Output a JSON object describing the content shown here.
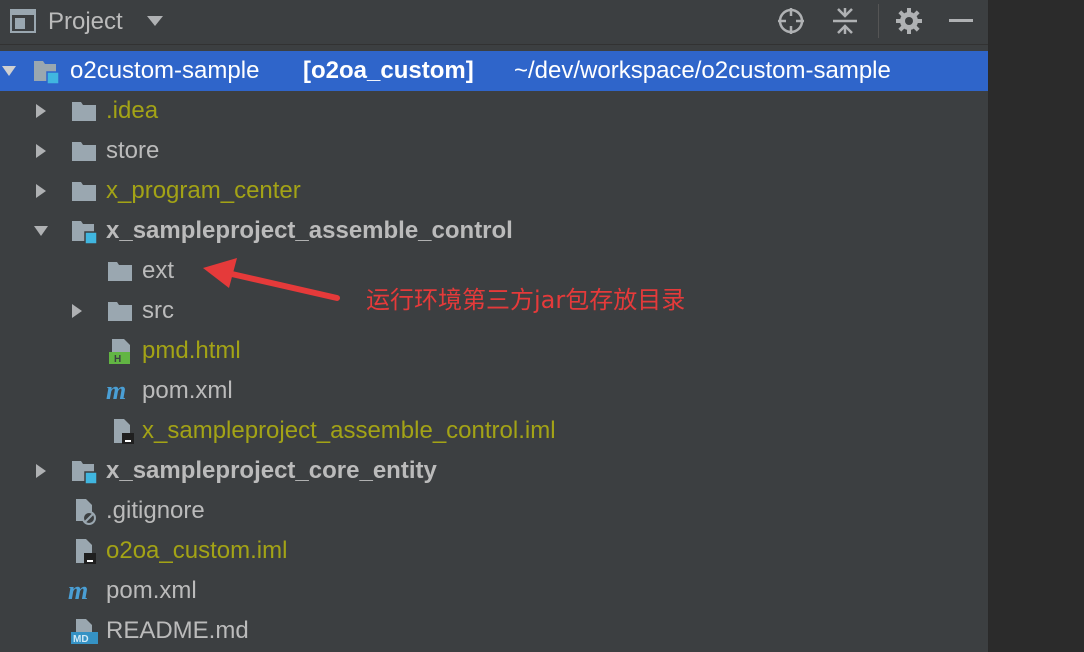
{
  "header": {
    "title": "Project",
    "icons": [
      "project-view-icon",
      "dropdown-caret-icon",
      "locate-icon",
      "collapse-all-icon",
      "gear-icon",
      "hide-icon"
    ]
  },
  "root": {
    "name": "o2custom-sample",
    "module": "[o2oa_custom]",
    "path": "~/dev/workspace/o2custom-sample"
  },
  "tree": [
    {
      "label": ".idea",
      "color": "#a3a316",
      "icon": "folder-icon",
      "expander": "collapsed"
    },
    {
      "label": "store",
      "color": "#bbbbbb",
      "icon": "folder-icon",
      "expander": "collapsed"
    },
    {
      "label": "x_program_center",
      "color": "#a3a316",
      "icon": "folder-icon",
      "expander": "collapsed"
    },
    {
      "label": "x_sampleproject_assemble_control",
      "color": "#bbbbbb",
      "icon": "module-folder-icon",
      "expander": "expanded",
      "bold": true
    },
    {
      "label": "ext",
      "color": "#bbbbbb",
      "icon": "folder-icon",
      "expander": "none"
    },
    {
      "label": "src",
      "color": "#bbbbbb",
      "icon": "folder-icon",
      "expander": "collapsed"
    },
    {
      "label": "pmd.html",
      "color": "#a3a316",
      "icon": "html-file-icon",
      "expander": "none"
    },
    {
      "label": "pom.xml",
      "color": "#bbbbbb",
      "icon": "maven-icon",
      "expander": "none"
    },
    {
      "label": "x_sampleproject_assemble_control.iml",
      "color": "#a3a316",
      "icon": "iml-file-icon",
      "expander": "none"
    },
    {
      "label": "x_sampleproject_core_entity",
      "color": "#bbbbbb",
      "icon": "module-folder-icon",
      "expander": "collapsed",
      "bold": true
    },
    {
      "label": ".gitignore",
      "color": "#bbbbbb",
      "icon": "ignored-file-icon",
      "expander": "none"
    },
    {
      "label": "o2oa_custom.iml",
      "color": "#a3a316",
      "icon": "iml-file-icon",
      "expander": "none"
    },
    {
      "label": "pom.xml",
      "color": "#bbbbbb",
      "icon": "maven-icon",
      "expander": "none"
    },
    {
      "label": "README.md",
      "color": "#bbbbbb",
      "icon": "markdown-file-icon",
      "expander": "none"
    }
  ],
  "annotation": {
    "text": "运行环境第三方jar包存放目录",
    "color": "#e53a3a"
  },
  "colors": {
    "selection": "#2f65ca",
    "panel": "#3c3f41",
    "olive": "#a3a316",
    "text": "#bbbbbb"
  }
}
